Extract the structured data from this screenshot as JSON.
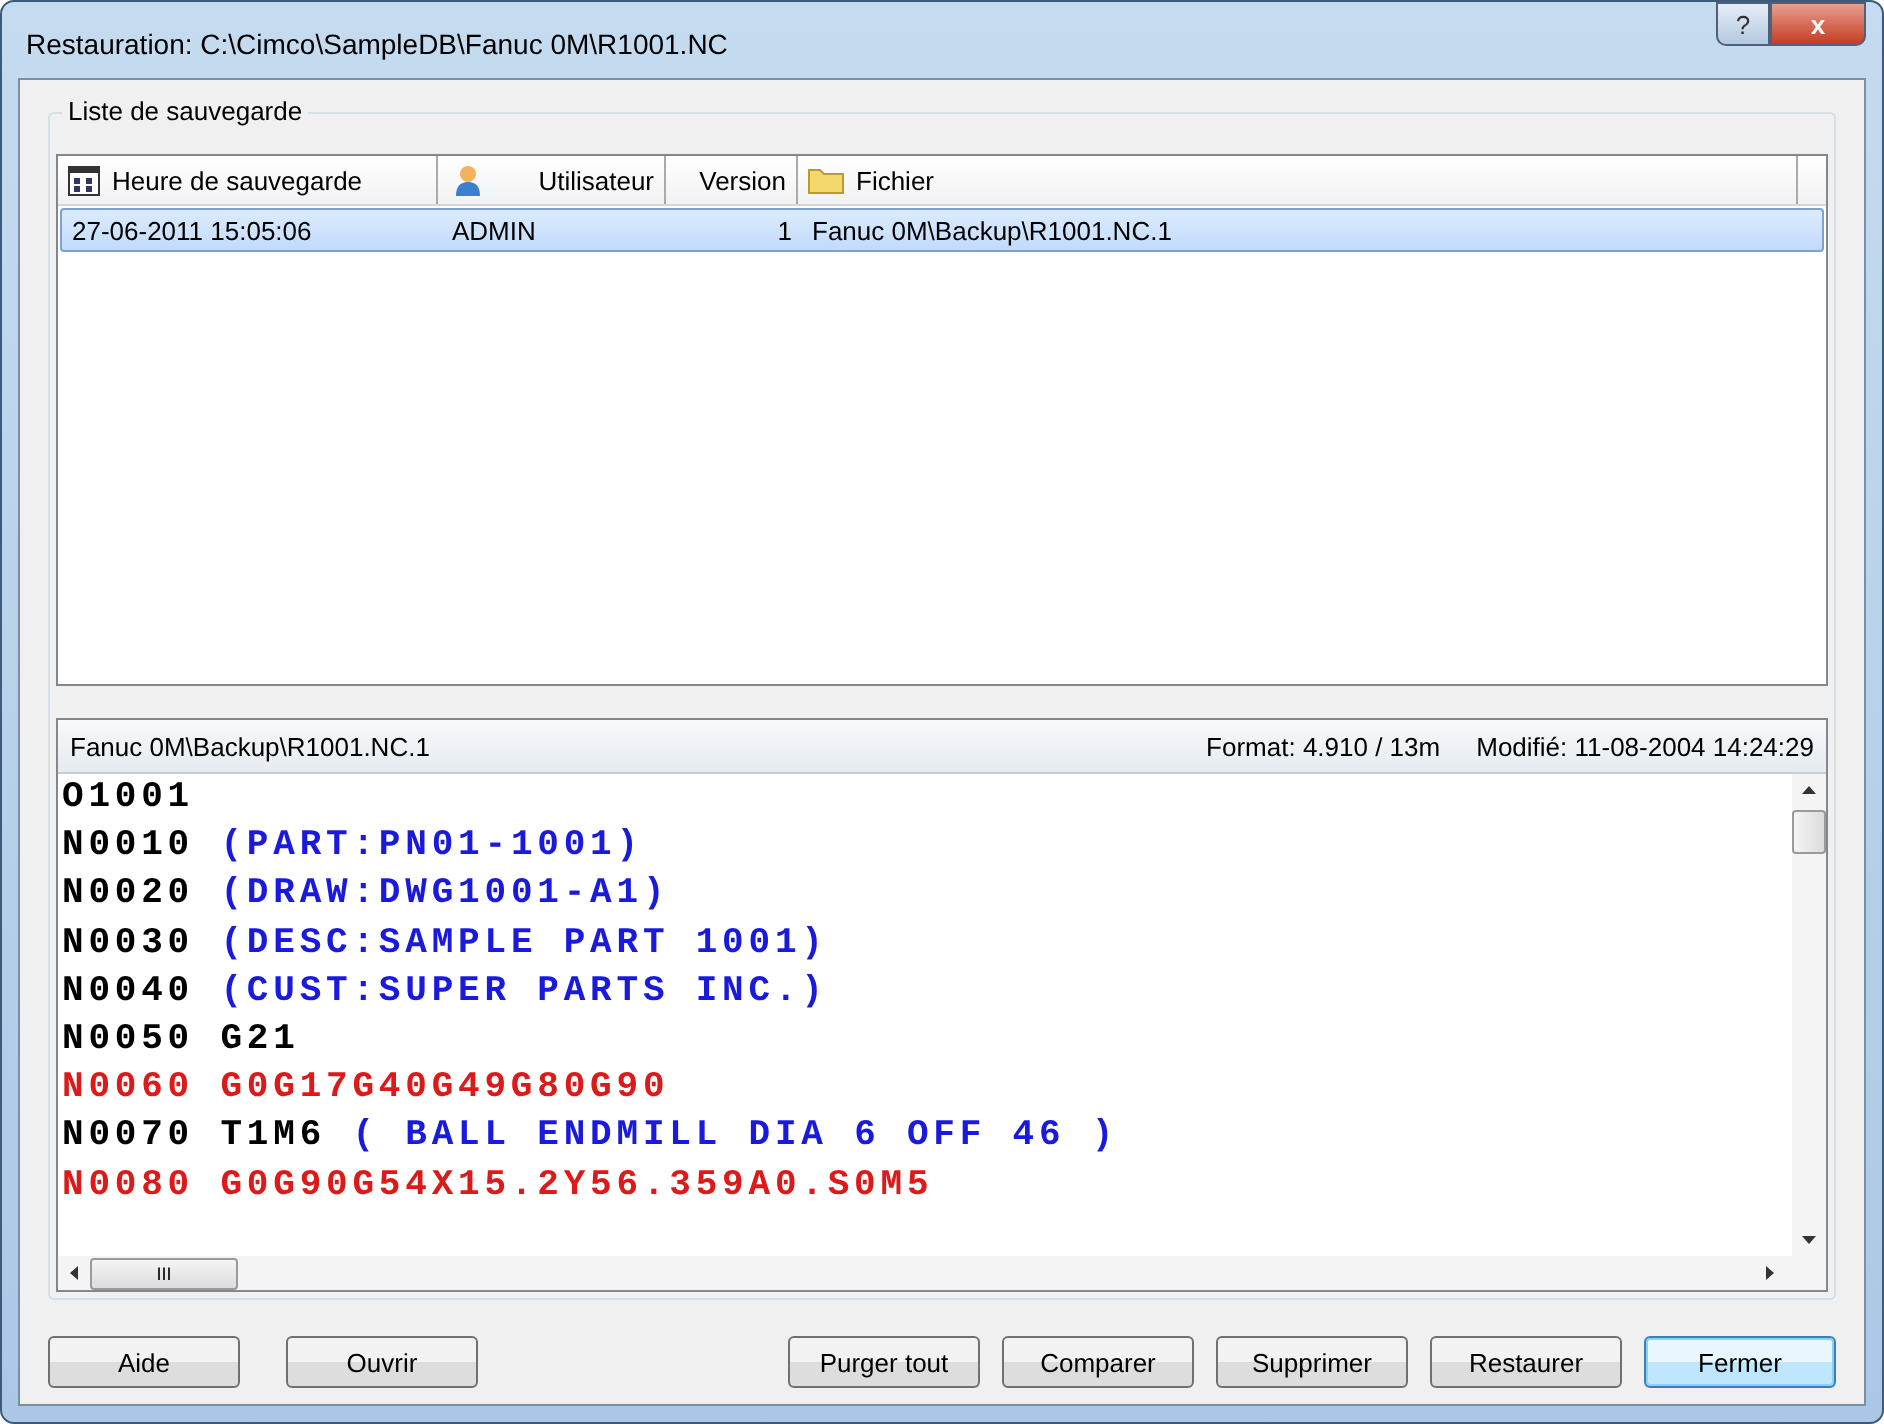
{
  "window": {
    "title": "Restauration: C:\\Cimco\\SampleDB\\Fanuc 0M\\R1001.NC"
  },
  "group": {
    "title": "Liste de sauvegarde"
  },
  "table": {
    "columns": [
      {
        "label": "Heure de sauvegarde"
      },
      {
        "label": "Utilisateur"
      },
      {
        "label": "Version"
      },
      {
        "label": "Fichier"
      }
    ],
    "rows": [
      {
        "selected": true,
        "cells": [
          "27-06-2011 15:05:06",
          "ADMIN",
          "1",
          "Fanuc 0M\\Backup\\R1001.NC.1"
        ]
      }
    ]
  },
  "preview": {
    "file": "Fanuc 0M\\Backup\\R1001.NC.1",
    "format": "Format: 4.910 / 13m",
    "modified": "Modifié: 11-08-2004 14:24:29",
    "lines": [
      [
        {
          "text": "O1001",
          "color": "#000000"
        }
      ],
      [
        {
          "text": "N0010 ",
          "color": "#000000"
        },
        {
          "text": "(PART:PN01-1001)",
          "color": "#1a1adc"
        }
      ],
      [
        {
          "text": "N0020 ",
          "color": "#000000"
        },
        {
          "text": "(DRAW:DWG1001-A1)",
          "color": "#1a1adc"
        }
      ],
      [
        {
          "text": "N0030 ",
          "color": "#000000"
        },
        {
          "text": "(DESC:SAMPLE PART 1001)",
          "color": "#1a1adc"
        }
      ],
      [
        {
          "text": "N0040 ",
          "color": "#000000"
        },
        {
          "text": "(CUST:SUPER PARTS INC.)",
          "color": "#1a1adc"
        }
      ],
      [
        {
          "text": "N0050 G21",
          "color": "#000000"
        }
      ],
      [
        {
          "text": "N0060 G0G17G40G49G80G90",
          "color": "#dc1a1a"
        }
      ],
      [
        {
          "text": "N0070 T1M6 ",
          "color": "#000000"
        },
        {
          "text": "( BALL ENDMILL DIA 6 OFF 46 )",
          "color": "#1a1adc"
        }
      ],
      [
        {
          "text": "N0080 G0G90G54X15.2Y56.359A0.S0M5",
          "color": "#dc1a1a"
        }
      ]
    ],
    "hscroll_label": "III"
  },
  "buttons": [
    {
      "label": "Aide",
      "default": false
    },
    {
      "label": "Ouvrir",
      "default": false
    },
    {
      "label": "Purger tout",
      "default": false
    },
    {
      "label": "Comparer",
      "default": false
    },
    {
      "label": "Supprimer",
      "default": false
    },
    {
      "label": "Restaurer",
      "default": false
    },
    {
      "label": "Fermer",
      "default": true
    }
  ],
  "title_buttons": [
    "?",
    "x"
  ]
}
